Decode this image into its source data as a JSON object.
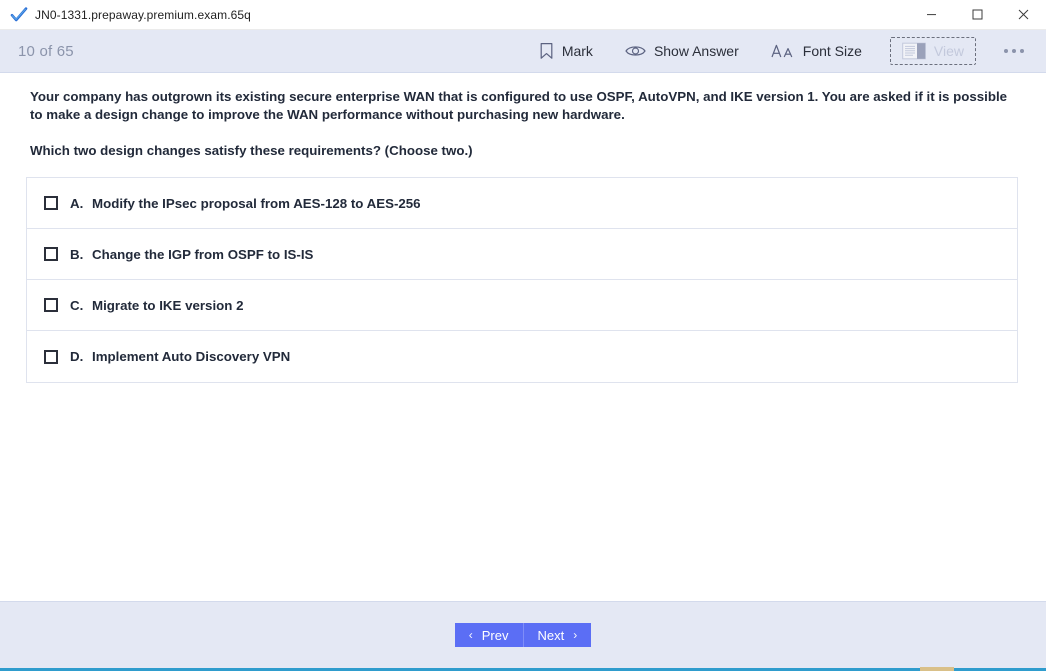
{
  "window": {
    "title": "JN0-1331.prepaway.premium.exam.65q",
    "app_icon": "blue-checkmark-icon",
    "controls": {
      "minimize": "–",
      "maximize": "□",
      "close": "✕"
    }
  },
  "toolbar": {
    "progress": "10 of 65",
    "items": [
      {
        "label": "Mark",
        "icon": "bookmark-icon",
        "disabled": false
      },
      {
        "label": "Show Answer",
        "icon": "eye-icon",
        "disabled": false
      },
      {
        "label": "Font Size",
        "icon": "font-size-icon",
        "disabled": false
      },
      {
        "label": "View",
        "icon": "view-layout-icon",
        "disabled": true
      }
    ],
    "more_label": "more-options"
  },
  "question": {
    "stem": "Your company has outgrown its existing secure enterprise WAN that is configured to use OSPF, AutoVPN, and IKE version 1. You are asked if it is possible to make a design change to improve the WAN performance without purchasing new hardware.",
    "instruction": "Which two design changes satisfy these requirements? (Choose two.)",
    "options": [
      {
        "letter": "A.",
        "text": "Modify the IPsec proposal from AES-128 to AES-256",
        "checked": false
      },
      {
        "letter": "B.",
        "text": "Change the IGP from OSPF to IS-IS",
        "checked": false
      },
      {
        "letter": "C.",
        "text": "Migrate to IKE version 2",
        "checked": false
      },
      {
        "letter": "D.",
        "text": "Implement Auto Discovery VPN",
        "checked": false
      }
    ]
  },
  "footer": {
    "prev_label": "Prev",
    "next_label": "Next",
    "prev_chevron": "‹",
    "next_chevron": "›"
  },
  "colors": {
    "toolbar_bg": "#e4e8f4",
    "accent_button": "#5b6ef5",
    "text": "#222a3a",
    "muted": "#8b94ab",
    "border": "#dfe3ee"
  }
}
